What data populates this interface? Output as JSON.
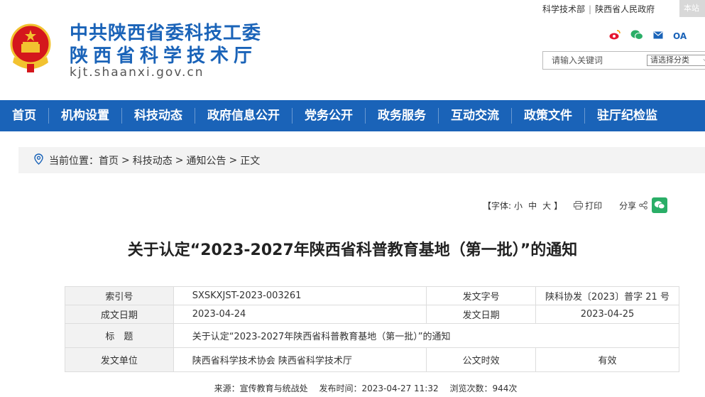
{
  "top_links": [
    "科学技术部",
    "陕西省人民政府"
  ],
  "lang_button": "本站",
  "site": {
    "title_line1": "中共陕西省委科技工委",
    "title_line2": "陕西省科学技术厅",
    "domain": "kjt.shaanxi.gov.cn"
  },
  "social": {
    "weibo": "weibo-icon",
    "wechat": "wechat-icon",
    "mail": "mail-icon",
    "oa": "OA"
  },
  "search": {
    "placeholder": "请输入关键词",
    "category": "请选择分类"
  },
  "nav": [
    "首页",
    "机构设置",
    "科技动态",
    "政府信息公开",
    "党务公开",
    "政务服务",
    "互动交流",
    "政策文件",
    "驻厅纪检监"
  ],
  "breadcrumb": {
    "label": "当前位置：",
    "items": [
      "首页",
      "科技动态",
      "通知公告",
      "正文"
    ],
    "separator": ">"
  },
  "tools": {
    "font_label": "【字体:",
    "sizes": [
      "小",
      "中",
      "大"
    ],
    "font_close": "】",
    "print": "打印",
    "share": "分享"
  },
  "headline": "关于认定“2023-2027年陕西省科普教育基地（第一批）”的通知",
  "meta": {
    "index_key": "索引号",
    "index_val": "SXSKXJST-2023-003261",
    "docno_key": "发文字号",
    "docno_val": "陕科协发〔2023〕普字 21 号",
    "written_key": "成文日期",
    "written_val": "2023-04-24",
    "issued_key": "发文日期",
    "issued_val": "2023-04-25",
    "title_key": "标　题",
    "title_val": "关于认定“2023-2027年陕西省科普教育基地（第一批）”的通知",
    "unit_key": "发文单位",
    "unit_val": "陕西省科学技术协会 陕西省科学技术厅",
    "validity_key": "公文时效",
    "validity_val": "有效"
  },
  "source_line": {
    "source": "来源：宣传教育与统战处",
    "published": "发布时间：2023-04-27 11:32",
    "views": "浏览次数：944次"
  },
  "colors": {
    "brand_blue": "#1a63b8",
    "emblem_red": "#d4161c",
    "emblem_gold": "#f2c230"
  }
}
